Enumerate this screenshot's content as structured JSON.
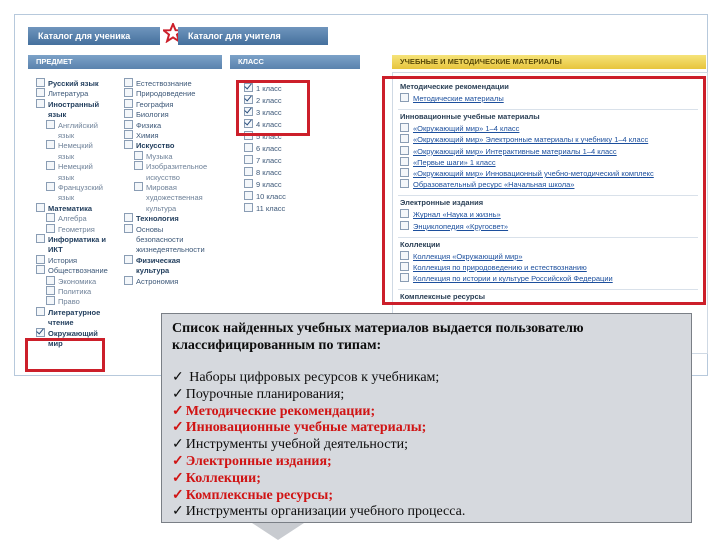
{
  "tabs": [
    {
      "label": "Каталог для ученика"
    },
    {
      "label": "Каталог для учителя"
    }
  ],
  "panels": {
    "subject_title": "ПРЕДМЕТ",
    "class_title": "КЛАСС",
    "materials_title": "УЧЕБНЫЕ И МЕТОДИЧЕСКИЕ МАТЕРИАЛЫ"
  },
  "subjects_col1": [
    {
      "label": "Русский язык",
      "checked": false,
      "style": "bold"
    },
    {
      "label": "Литература",
      "checked": false,
      "style": "normal"
    },
    {
      "label": "Иностранный",
      "checked": false,
      "style": "bold"
    },
    {
      "label": "язык",
      "checked": null,
      "style": "bold"
    },
    {
      "label": "Английский",
      "checked": false,
      "style": "sub"
    },
    {
      "label": "язык",
      "checked": null,
      "style": "sub"
    },
    {
      "label": "Немецкий",
      "checked": false,
      "style": "sub"
    },
    {
      "label": "язык",
      "checked": null,
      "style": "sub"
    },
    {
      "label": "Немецкий",
      "checked": false,
      "style": "sub"
    },
    {
      "label": "язык",
      "checked": null,
      "style": "sub"
    },
    {
      "label": "Французский",
      "checked": false,
      "style": "sub"
    },
    {
      "label": "язык",
      "checked": null,
      "style": "sub"
    },
    {
      "label": "Математика",
      "checked": false,
      "style": "bold"
    },
    {
      "label": "Алгебра",
      "checked": false,
      "style": "sub"
    },
    {
      "label": "Геометрия",
      "checked": false,
      "style": "sub"
    },
    {
      "label": "Информатика и",
      "checked": false,
      "style": "bold"
    },
    {
      "label": "ИКТ",
      "checked": null,
      "style": "bold"
    },
    {
      "label": "История",
      "checked": false,
      "style": "normal"
    },
    {
      "label": "Обществознание",
      "checked": false,
      "style": "normal"
    },
    {
      "label": "Экономика",
      "checked": false,
      "style": "sub"
    },
    {
      "label": "Политика",
      "checked": false,
      "style": "sub"
    },
    {
      "label": "Право",
      "checked": false,
      "style": "sub"
    },
    {
      "label": "Литературное",
      "checked": false,
      "style": "bold"
    },
    {
      "label": "чтение",
      "checked": null,
      "style": "bold"
    },
    {
      "label": "Окружающий",
      "checked": true,
      "style": "bold"
    },
    {
      "label": "мир",
      "checked": null,
      "style": "bold"
    }
  ],
  "subjects_col2": [
    {
      "label": "Естествознание",
      "checked": false,
      "style": "normal"
    },
    {
      "label": "Природоведение",
      "checked": false,
      "style": "normal"
    },
    {
      "label": "География",
      "checked": false,
      "style": "normal"
    },
    {
      "label": "Биология",
      "checked": false,
      "style": "normal"
    },
    {
      "label": "Физика",
      "checked": false,
      "style": "normal"
    },
    {
      "label": "Химия",
      "checked": false,
      "style": "normal"
    },
    {
      "label": "Искусство",
      "checked": false,
      "style": "bold"
    },
    {
      "label": "Музыка",
      "checked": false,
      "style": "sub"
    },
    {
      "label": "Изобразительное",
      "checked": false,
      "style": "sub"
    },
    {
      "label": "искусство",
      "checked": null,
      "style": "sub"
    },
    {
      "label": "Мировая",
      "checked": false,
      "style": "sub"
    },
    {
      "label": "художественная",
      "checked": null,
      "style": "sub"
    },
    {
      "label": "культура",
      "checked": null,
      "style": "sub"
    },
    {
      "label": "Технология",
      "checked": false,
      "style": "bold"
    },
    {
      "label": "Основы",
      "checked": false,
      "style": "normal"
    },
    {
      "label": "безопасности",
      "checked": null,
      "style": "normal"
    },
    {
      "label": "жизнедеятельности",
      "checked": null,
      "style": "normal"
    },
    {
      "label": "Физическая",
      "checked": false,
      "style": "bold"
    },
    {
      "label": "культура",
      "checked": null,
      "style": "bold"
    },
    {
      "label": "Астрономия",
      "checked": false,
      "style": "normal"
    }
  ],
  "classes": [
    {
      "label": "1 класс",
      "checked": true
    },
    {
      "label": "2 класс",
      "checked": true
    },
    {
      "label": "3 класс",
      "checked": true
    },
    {
      "label": "4 класс",
      "checked": true
    },
    {
      "label": "5 класс",
      "checked": false
    },
    {
      "label": "6 класс",
      "checked": false
    },
    {
      "label": "7 класс",
      "checked": false
    },
    {
      "label": "8 класс",
      "checked": false
    },
    {
      "label": "9 класс",
      "checked": false
    },
    {
      "label": "10 класс",
      "checked": false
    },
    {
      "label": "11 класс",
      "checked": false
    }
  ],
  "materials": [
    {
      "title": "Методические рекомендации",
      "links": [
        "Методические материалы"
      ]
    },
    {
      "title": "Инновационные учебные материалы",
      "links": [
        "«Окружающий мир» 1–4 класс",
        "«Окружающий мир» Электронные материалы к учебнику 1–4 класс",
        "«Окружающий мир» Интерактивные материалы 1–4 класс",
        "«Первые шаги» 1 класс",
        "«Окружающий мир» Инновационный учебно-методический комплекс",
        "Образовательный ресурс «Начальная школа»"
      ]
    },
    {
      "title": "Электронные издания",
      "links": [
        "Журнал «Наука и жизнь»",
        "Энциклопедия «Кругосвет»"
      ]
    },
    {
      "title": "Коллекции",
      "links": [
        "Коллекция «Окружающий мир»",
        "Коллекция по природоведению и естествознанию",
        "Коллекция по истории и культуре Российской Федерации"
      ]
    },
    {
      "title": "Комплексные ресурсы",
      "links": []
    }
  ],
  "popup": {
    "title": "Список найденных учебных материалов выдается пользователю классифицированным по типам:",
    "items": [
      {
        "text": " Наборы цифровых ресурсов к учебникам;",
        "highlight": false
      },
      {
        "text": "Поурочные планирования;",
        "highlight": false
      },
      {
        "text": "Методические рекомендации;",
        "highlight": true
      },
      {
        "text": "Инновационные учебные материалы;",
        "highlight": true
      },
      {
        "text": "Инструменты учебной деятельности;",
        "highlight": false
      },
      {
        "text": "Электронные издания;",
        "highlight": true
      },
      {
        "text": "Коллекции;",
        "highlight": true
      },
      {
        "text": "Комплексные ресурсы;",
        "highlight": true
      },
      {
        "text": "Инструменты организации учебного процесса.",
        "highlight": false
      }
    ]
  },
  "colors": {
    "highlight": "#cc1f2a",
    "popup_red": "#d01414",
    "tab_blue": "#45709d",
    "materials_header": "#e7c53d"
  }
}
